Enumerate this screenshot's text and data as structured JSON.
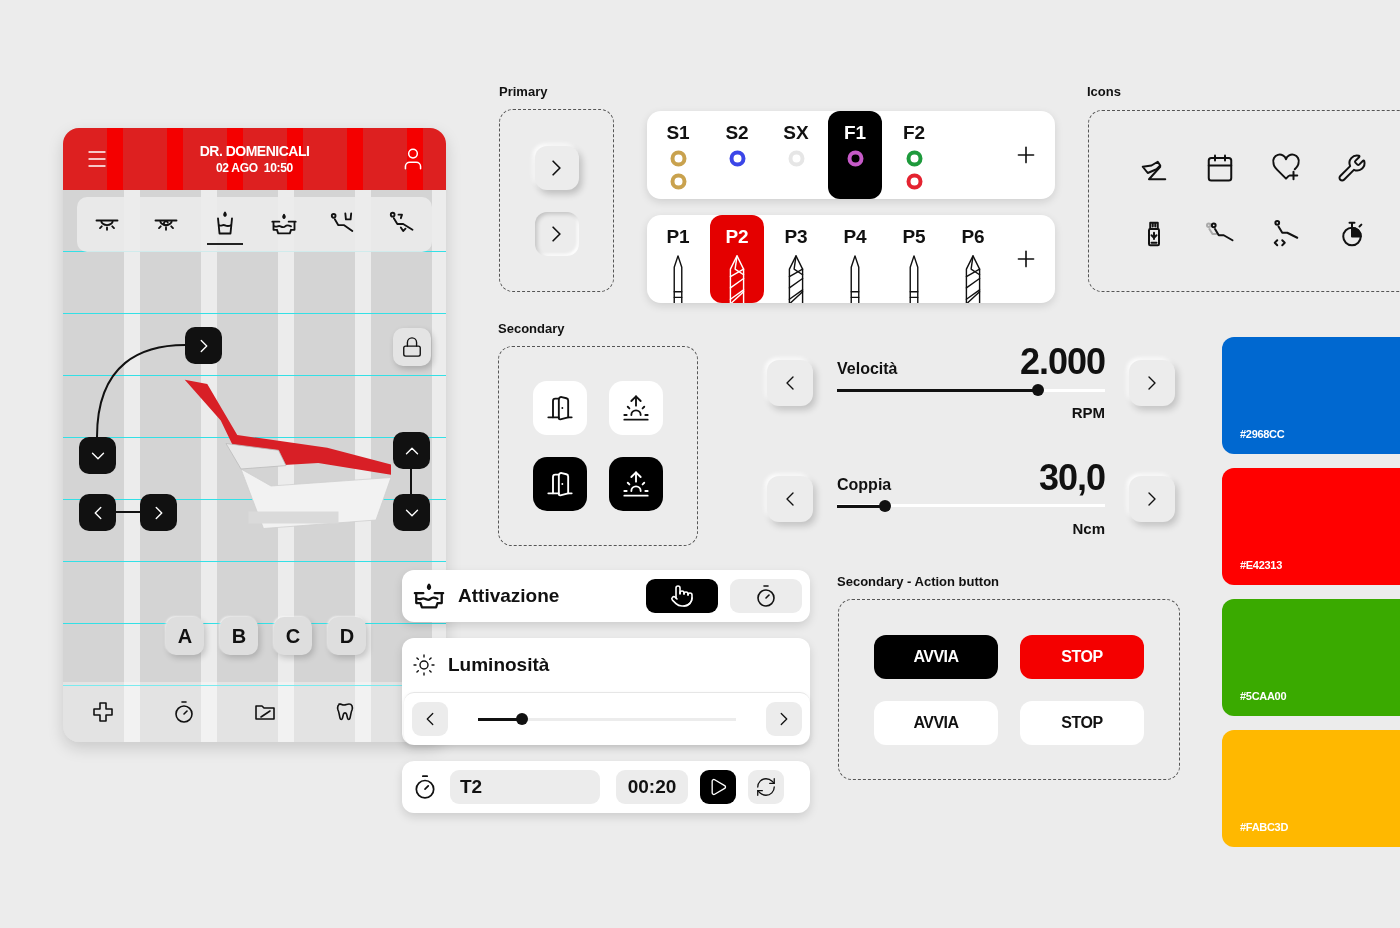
{
  "phone": {
    "title": "DR. DOMENICALI",
    "datetime": "02 AGO  10:50",
    "tabs": [
      {
        "kind": "lamp",
        "selected": false
      },
      {
        "kind": "lamp_c",
        "selected": false
      },
      {
        "kind": "cup",
        "selected": true
      },
      {
        "kind": "basin",
        "selected": false
      },
      {
        "kind": "chair_cup",
        "selected": false
      },
      {
        "kind": "chair_recline",
        "selected": false
      }
    ],
    "presets": [
      {
        "label": "A"
      },
      {
        "label": "B"
      },
      {
        "label": "C"
      },
      {
        "label": "D"
      }
    ],
    "nav": [
      {
        "kind": "plus"
      },
      {
        "kind": "timer"
      },
      {
        "kind": "folder"
      },
      {
        "kind": "tooth"
      }
    ]
  },
  "primary": {
    "label": "Primary",
    "buttons": [
      {
        "pressed": false
      },
      {
        "pressed": true
      }
    ]
  },
  "syringes": {
    "items": [
      {
        "label": "S1",
        "selected": false,
        "rings": [
          {
            "color": "#c9a24e"
          },
          {
            "color": "#c9a24e"
          }
        ]
      },
      {
        "label": "S2",
        "selected": false,
        "rings": [
          {
            "color": "#3b46e8"
          }
        ]
      },
      {
        "label": "SX",
        "selected": false,
        "rings": [
          {
            "color": "#e6e6e6"
          }
        ]
      },
      {
        "label": "F1",
        "selected": true,
        "rings": [
          {
            "color": "#c65ac8"
          }
        ]
      },
      {
        "label": "F2",
        "selected": false,
        "rings": [
          {
            "color": "#1e9a3c"
          },
          {
            "color": "#e42330"
          }
        ]
      }
    ]
  },
  "burs": {
    "items": [
      {
        "label": "P1",
        "selected": false,
        "kind": "needle"
      },
      {
        "label": "P2",
        "selected": true,
        "kind": "twist"
      },
      {
        "label": "P3",
        "selected": false,
        "kind": "twist"
      },
      {
        "label": "P4",
        "selected": false,
        "kind": "needle"
      },
      {
        "label": "P5",
        "selected": false,
        "kind": "needle"
      },
      {
        "label": "P6",
        "selected": false,
        "kind": "twist"
      }
    ]
  },
  "icons": {
    "label": "Icons",
    "items": [
      {
        "kind": "pedal"
      },
      {
        "kind": "calendar"
      },
      {
        "kind": "heart_plus"
      },
      {
        "kind": "wrench"
      },
      {
        "kind": "usb"
      },
      {
        "kind": "chair_memory"
      },
      {
        "kind": "chair_move"
      },
      {
        "kind": "stopwatch"
      }
    ]
  },
  "secondary": {
    "label": "Secondary",
    "buttons": [
      {
        "kind": "door",
        "selected": false
      },
      {
        "kind": "sunrise",
        "selected": false
      },
      {
        "kind": "door",
        "selected": true
      },
      {
        "kind": "sunrise",
        "selected": true
      }
    ]
  },
  "sliders": [
    {
      "label": "Velocità",
      "value": "2.000",
      "unit": "RPM",
      "level": 0.75
    },
    {
      "label": "Coppia",
      "value": "30,0",
      "unit": "Ncm",
      "level": 0.18
    }
  ],
  "activation": {
    "label": "Attivazione",
    "modes": [
      {
        "kind": "touch",
        "selected": true
      },
      {
        "kind": "timer",
        "selected": false
      }
    ]
  },
  "brightness": {
    "label": "Luminosità",
    "level": 0.17
  },
  "timer": {
    "name": "T2",
    "time": "00:20"
  },
  "actions": {
    "label": "Secondary - Action button",
    "buttons": [
      {
        "label": "AVVIA",
        "kind": "dark"
      },
      {
        "label": "STOP",
        "kind": "danger"
      },
      {
        "label": "AVVIA",
        "kind": "plain"
      },
      {
        "label": "STOP",
        "kind": "plain"
      }
    ]
  },
  "swatches": [
    {
      "label": "#2968CC",
      "color": "#0068d0"
    },
    {
      "label": "#E42313",
      "color": "#ff0000"
    },
    {
      "label": "#5CAA00",
      "color": "#3aaa00"
    },
    {
      "label": "#FABC3D",
      "color": "#ffb800"
    }
  ]
}
